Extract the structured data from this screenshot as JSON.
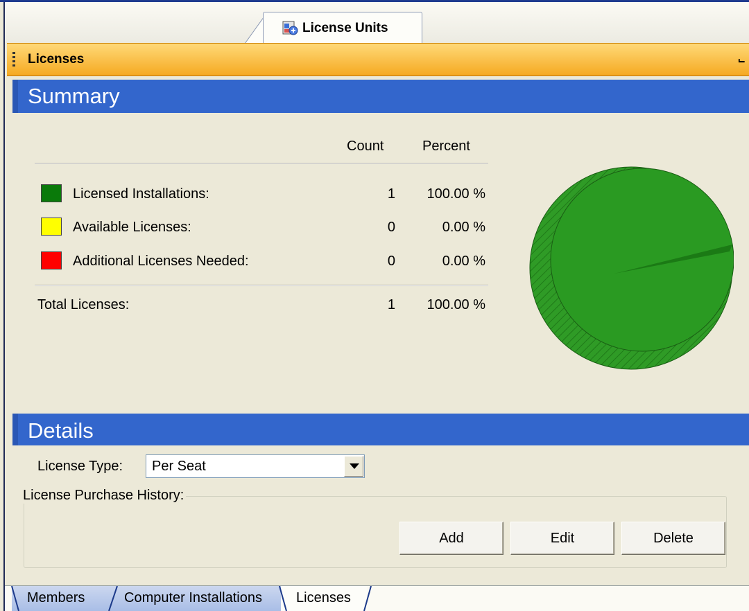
{
  "document_tab": {
    "label": "License Units"
  },
  "pane": {
    "title": "Licenses",
    "pin_glyph": "⨽"
  },
  "summary": {
    "title": "Summary",
    "columns": {
      "count": "Count",
      "percent": "Percent"
    },
    "rows": [
      {
        "label": "Licensed Installations:",
        "count": "1",
        "percent": "100.00 %",
        "color": "#0a8a0a"
      },
      {
        "label": "Available Licenses:",
        "count": "0",
        "percent": "0.00 %",
        "color": "#ffff00"
      },
      {
        "label": "Additional Licenses Needed:",
        "count": "0",
        "percent": "0.00 %",
        "color": "#ff0000"
      }
    ],
    "total": {
      "label": "Total Licenses:",
      "count": "1",
      "percent": "100.00 %"
    }
  },
  "chart_data": {
    "type": "pie",
    "categories": [
      "Licensed Installations",
      "Available Licenses",
      "Additional Licenses Needed"
    ],
    "values": [
      1,
      0,
      0
    ],
    "colors": [
      "#2a9a22",
      "#ffff00",
      "#ff0000"
    ]
  },
  "details": {
    "title": "Details",
    "license_type_label": "License Type:",
    "license_type_value": "Per Seat",
    "purchase_history_label": "License Purchase History:",
    "buttons": {
      "add": "Add",
      "edit": "Edit",
      "delete": "Delete"
    }
  },
  "bottom_tabs": [
    {
      "label": "Members",
      "active": false
    },
    {
      "label": "Computer Installations",
      "active": false
    },
    {
      "label": "Licenses",
      "active": true
    }
  ]
}
